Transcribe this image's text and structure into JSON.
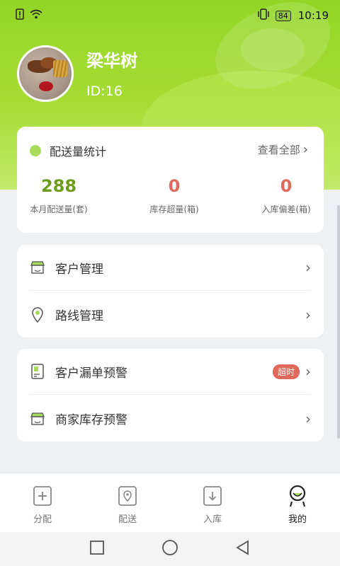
{
  "status_bar": {
    "battery": "84",
    "time": "10:19",
    "icons": [
      "alert-sim-icon",
      "wifi-icon",
      "vibrate-icon",
      "battery-icon"
    ]
  },
  "profile": {
    "name": "梁华树",
    "id_label": "ID:16"
  },
  "stats": {
    "title": "配送量统计",
    "view_all": "查看全部",
    "items": [
      {
        "value": "288",
        "label": "本月配送量(套)",
        "color": "#6e9a1d"
      },
      {
        "value": "0",
        "label": "库存超量(箱)",
        "color": "#e06b5d"
      },
      {
        "value": "0",
        "label": "入库偏差(箱)",
        "color": "#e06b5d"
      }
    ]
  },
  "menu_group1": [
    {
      "label": "客户管理",
      "icon": "shop-icon"
    },
    {
      "label": "路线管理",
      "icon": "location-pin-icon"
    }
  ],
  "menu_group2": [
    {
      "label": "客户漏单预警",
      "icon": "document-icon",
      "badge": "超时"
    },
    {
      "label": "商家库存预警",
      "icon": "shop-icon"
    }
  ],
  "bottom_nav": [
    {
      "label": "分配",
      "icon": "plus-square-icon"
    },
    {
      "label": "配送",
      "icon": "location-doc-icon"
    },
    {
      "label": "入库",
      "icon": "download-doc-icon"
    },
    {
      "label": "我的",
      "icon": "profile-mascot-icon",
      "active": true
    }
  ],
  "colors": {
    "accent_green": "#93d627",
    "warning_red": "#e06b5d"
  }
}
